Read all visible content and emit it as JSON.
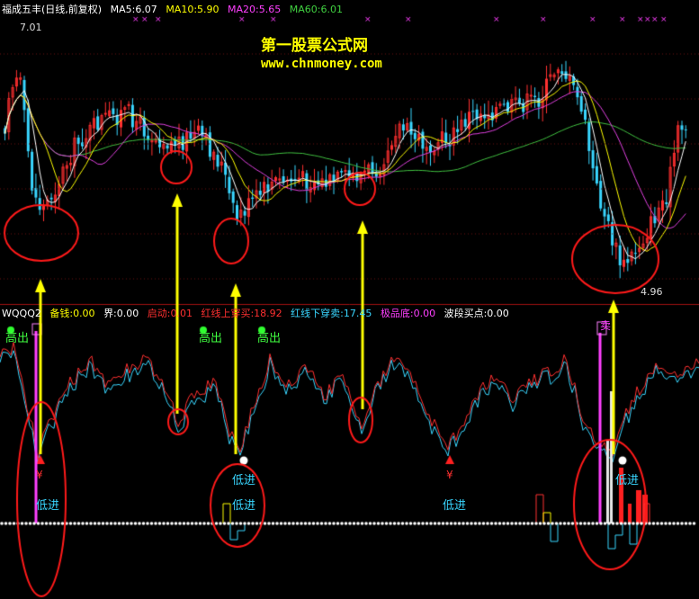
{
  "colors": {
    "background": "#000000",
    "up_candle": "#ff3030",
    "down_candle": "#39d6ff",
    "ma5": "#ffffff",
    "ma10": "#ffff00",
    "ma20": "#e040e0",
    "ma60": "#40c040",
    "annotation": "#ff1a1a",
    "arrow": "#ffff00",
    "panel_border": "#a01010"
  },
  "top_panel": {
    "title": "福成五丰(日线,前复权)",
    "ma": [
      {
        "label": "MA5:6.07",
        "color": "#ffffff"
      },
      {
        "label": "MA10:5.90",
        "color": "#ffff00"
      },
      {
        "label": "MA20:5.65",
        "color": "#ff40ff"
      },
      {
        "label": "MA60:6.01",
        "color": "#40d040"
      }
    ],
    "high_label": "7.01",
    "low_label": "4.96",
    "watermark_title": "第一股票公式网",
    "watermark_url": "www.chnmoney.com"
  },
  "bottom_panel": {
    "indicator_name": "WQQQ2",
    "items": [
      {
        "label": "备钱:0.00",
        "color": "#ffff00"
      },
      {
        "label": "界:0.00",
        "color": "#ffffff"
      },
      {
        "label": "启动:0.01",
        "color": "#ff3030"
      },
      {
        "label": "红线上穿买:18.92",
        "color": "#ff3030"
      },
      {
        "label": "红线下穿卖:17.45",
        "color": "#39d6ff"
      },
      {
        "label": "极品底:0.00",
        "color": "#ff40ff"
      },
      {
        "label": "波段买点:0.00",
        "color": "#ffffff"
      }
    ],
    "signal_high": "高出",
    "signal_low": "低进",
    "signal_buy": "¥",
    "signal_sell": "卖"
  },
  "chart_data": {
    "type": "candlestick with indicator panel",
    "price_range": [
      4.96,
      7.01
    ],
    "moving_averages": {
      "MA5": 6.07,
      "MA10": 5.9,
      "MA20": 5.65,
      "MA60": 6.01
    },
    "indicator_values": {
      "备钱": 0.0,
      "界": 0.0,
      "启动": 0.01,
      "红线上穿买": 18.92,
      "红线下穿卖": 17.45,
      "极品底": 0.0,
      "波段买点": 0.0
    },
    "high_out_signals": 3,
    "low_in_signals": 5,
    "circled_lows": 6
  }
}
